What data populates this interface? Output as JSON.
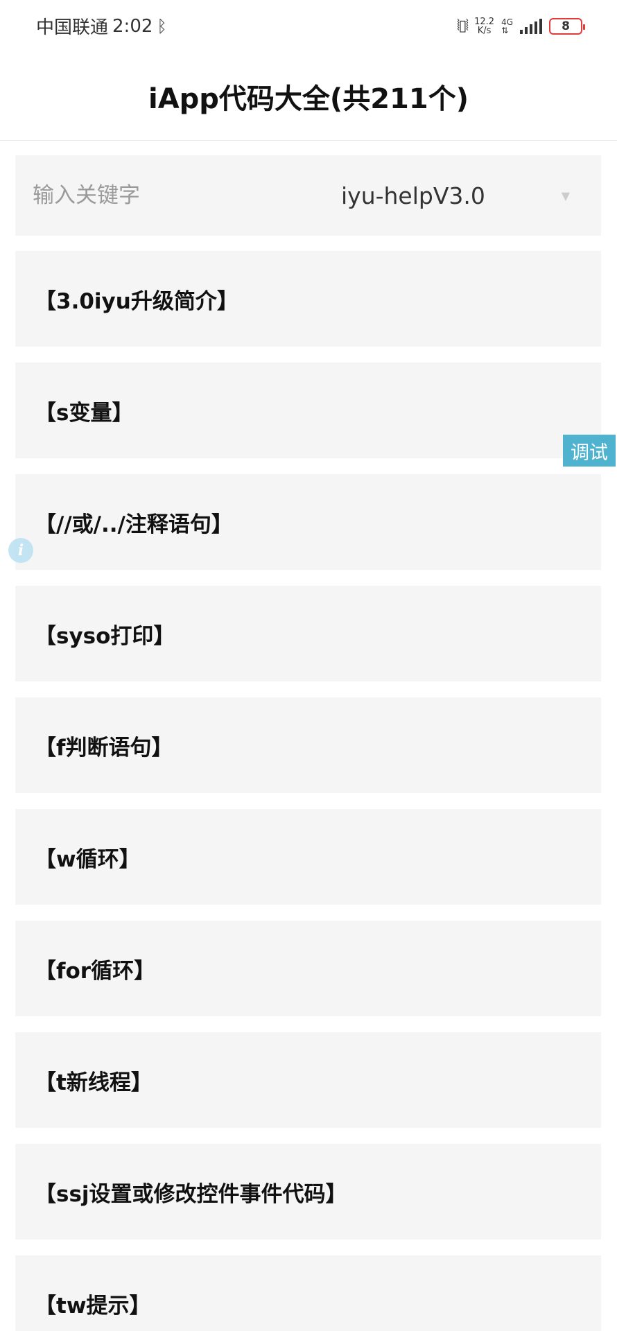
{
  "status_bar": {
    "carrier": "中国联通",
    "time": "2:02",
    "net_speed_value": "12.2",
    "net_speed_unit": "K/s",
    "net_type": "4G",
    "battery": "8"
  },
  "header": {
    "title": "iApp代码大全(共211个)"
  },
  "search": {
    "placeholder": "输入关键字",
    "version": "iyu-helpV3.0"
  },
  "items": [
    {
      "label": "【3.0iyu升级简介】"
    },
    {
      "label": "【s变量】"
    },
    {
      "label": "【//或/../注释语句】"
    },
    {
      "label": "【syso打印】"
    },
    {
      "label": "【f判断语句】"
    },
    {
      "label": "【w循环】"
    },
    {
      "label": "【for循环】"
    },
    {
      "label": "【t新线程】"
    },
    {
      "label": "【ssj设置或修改控件事件代码】"
    },
    {
      "label": "【tw提示】"
    }
  ],
  "debug_button": {
    "label": "调试"
  },
  "colors": {
    "debug_tab": "#4fb3cf",
    "battery_low": "#e23b3b",
    "item_bg": "#f5f5f5"
  }
}
